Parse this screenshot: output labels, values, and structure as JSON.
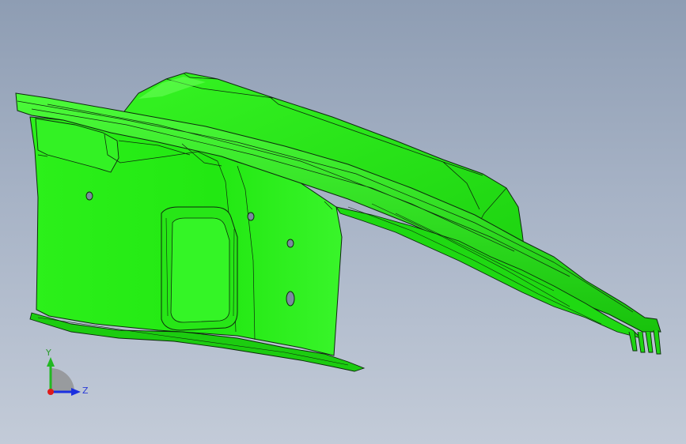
{
  "viewport": {
    "part_color": "#22ee11",
    "edge_color": "#0d2a0d",
    "highlight_color": "#5cff4a",
    "shadow_color": "#12b80a"
  },
  "triad": {
    "y_label": "Y",
    "z_label": "Z",
    "y_color": "#22b822",
    "z_color": "#1a2fe0",
    "x_color": "#e01a1a"
  }
}
